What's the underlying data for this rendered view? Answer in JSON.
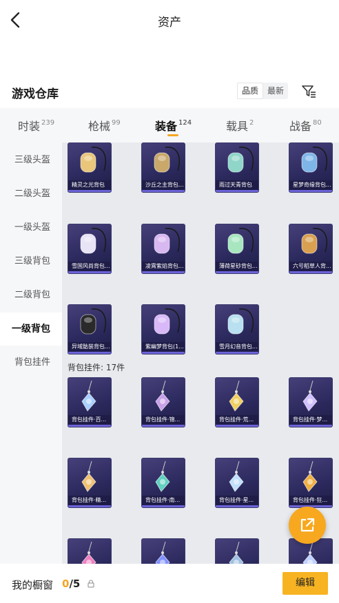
{
  "header": {
    "title": "资产"
  },
  "section": {
    "title": "游戏仓库"
  },
  "sort": {
    "options": [
      "品质",
      "最新"
    ]
  },
  "tabs": [
    {
      "label": "时装",
      "count": "239"
    },
    {
      "label": "枪械",
      "count": "99"
    },
    {
      "label": "装备",
      "count": "124"
    },
    {
      "label": "载具",
      "count": "2"
    },
    {
      "label": "战备",
      "count": "80"
    }
  ],
  "sidebar": {
    "items": [
      {
        "label": "三级头盔"
      },
      {
        "label": "二级头盔"
      },
      {
        "label": "一级头盔"
      },
      {
        "label": "三级背包"
      },
      {
        "label": "二级背包"
      },
      {
        "label": "一级背包"
      },
      {
        "label": "背包挂件"
      }
    ]
  },
  "backpacks": {
    "items": [
      {
        "label": "精灵之光背包",
        "icon": "yellow-backpack-icon"
      },
      {
        "label": "沙丘之主背包...",
        "icon": "bone-backpack-icon"
      },
      {
        "label": "雨过天青背包",
        "icon": "teal-backpack-icon"
      },
      {
        "label": "星梦奇缘背包...",
        "icon": "swan-backpack-icon"
      },
      {
        "label": "雪国风尚背包...",
        "icon": "bunny-backpack-icon"
      },
      {
        "label": "凌霄紫焰背包...",
        "icon": "shell-backpack-icon"
      },
      {
        "label": "薄荷星砂背包...",
        "icon": "mint-backpack-icon"
      },
      {
        "label": "六号稻草人背...",
        "icon": "scarecrow-backpack-icon"
      },
      {
        "label": "异域骷装背包...",
        "icon": "skull-backpack-icon"
      },
      {
        "label": "紫幽梦背包(1...",
        "icon": "purple-bunny-backpack-icon"
      },
      {
        "label": "雪月幻音背包...",
        "icon": "moon-backpack-icon"
      }
    ]
  },
  "charms": {
    "group_label": "背包挂件: 17件",
    "items": [
      {
        "label": "背包挂件·百...",
        "icon": "heart-charm-icon"
      },
      {
        "label": "背包挂件·锦...",
        "icon": "axe-charm-icon"
      },
      {
        "label": "背包挂件·荒...",
        "icon": "star-charm-icon"
      },
      {
        "label": "背包挂件·梦...",
        "icon": "jellyfish-charm-icon"
      },
      {
        "label": "背包挂件·精...",
        "icon": "feather-charm-icon"
      },
      {
        "label": "背包挂件·南...",
        "icon": "sword-charm-icon"
      },
      {
        "label": "背包挂件·星...",
        "icon": "gem-charm-icon"
      },
      {
        "label": "背包挂件·狂...",
        "icon": "blade-charm-icon"
      },
      {
        "label": "",
        "icon": "flower-charm-icon"
      },
      {
        "label": "",
        "icon": "mask-charm-icon"
      },
      {
        "label": "",
        "icon": "hook-charm-icon"
      },
      {
        "label": "",
        "icon": "orb-charm-icon"
      }
    ]
  },
  "footer": {
    "showcase_label": "我的橱窗",
    "count_current": "0",
    "count_total": "/5",
    "edit_label": "编辑"
  },
  "colors": {
    "accent": "#f7a81e",
    "card": "#2c2a5e"
  }
}
